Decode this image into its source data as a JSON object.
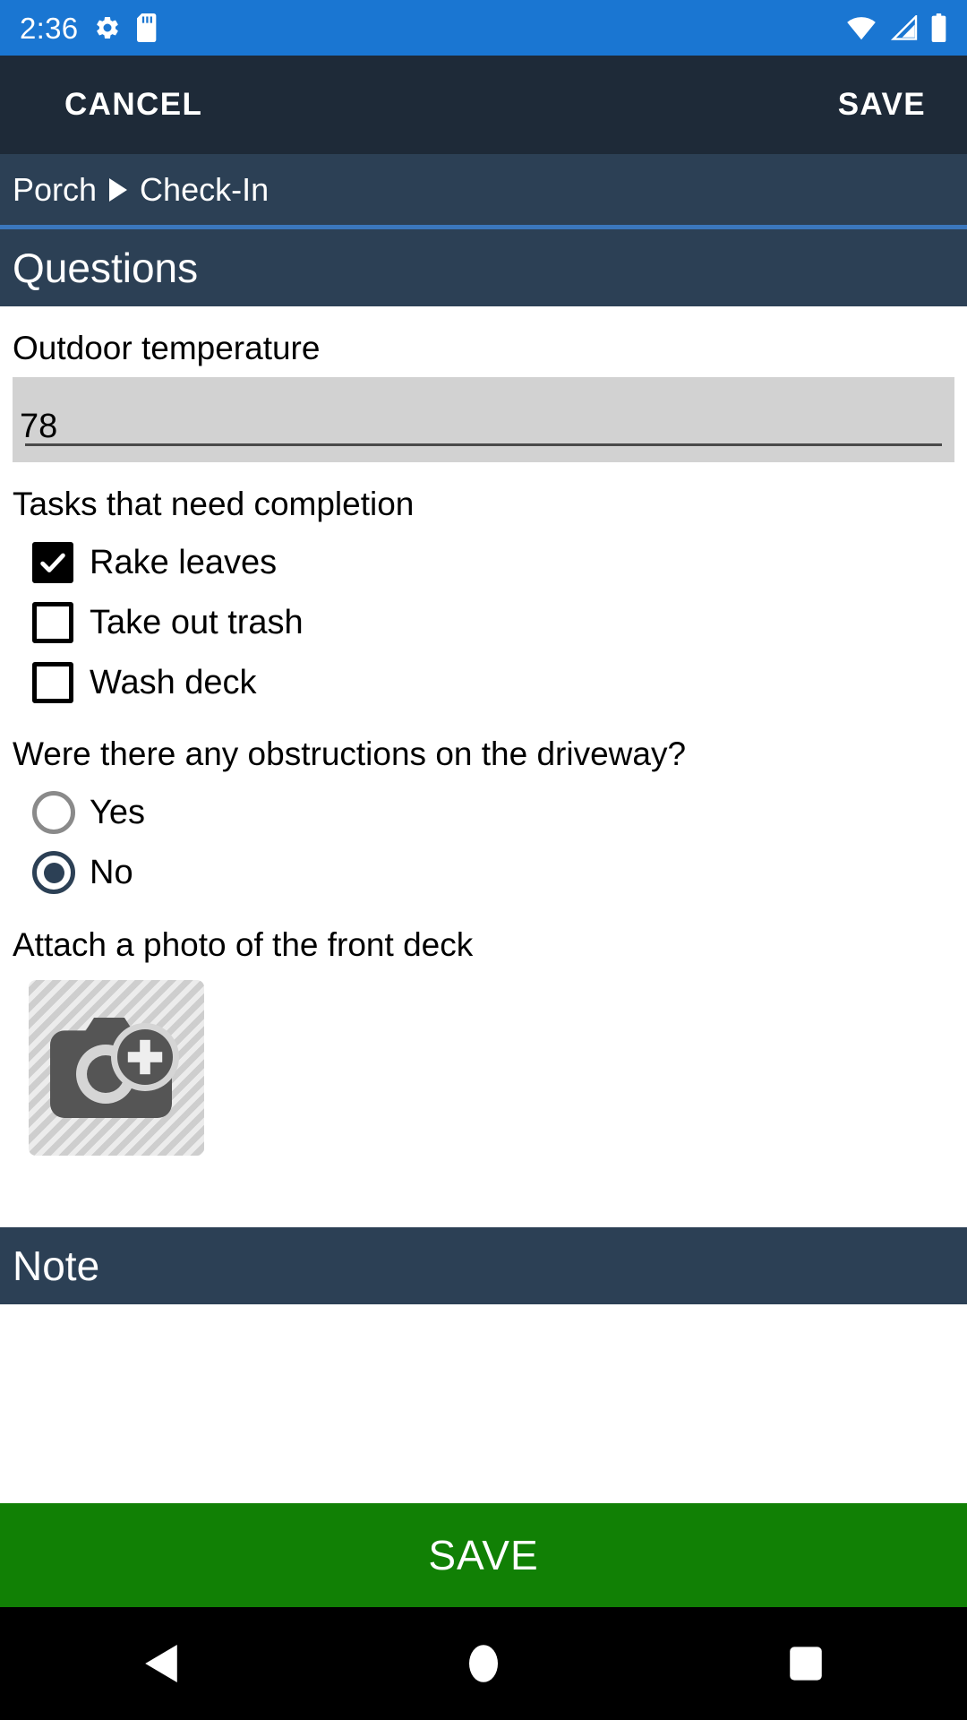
{
  "statusbar": {
    "time": "2:36",
    "icons_left": [
      "gear-icon",
      "sd-card-icon"
    ],
    "icons_right": [
      "wifi-icon",
      "cellular-signal-icon",
      "battery-icon"
    ],
    "background_color": "#1a76d2"
  },
  "appbar": {
    "cancel_label": "CANCEL",
    "save_label": "SAVE",
    "background_color": "#1e2a38"
  },
  "breadcrumb": {
    "parent": "Porch",
    "separator_icon": "triangle-right-icon",
    "current": "Check-In",
    "background_color": "#2c4055",
    "accent_color": "#3b77bd"
  },
  "sections": {
    "questions": {
      "title": "Questions"
    },
    "note": {
      "title": "Note"
    }
  },
  "questions": [
    {
      "type": "text",
      "label": "Outdoor temperature",
      "value": "78",
      "placeholder": ""
    },
    {
      "type": "checkbox-group",
      "label": "Tasks that need completion",
      "options": [
        {
          "label": "Rake leaves",
          "checked": true
        },
        {
          "label": "Take out trash",
          "checked": false
        },
        {
          "label": "Wash deck",
          "checked": false
        }
      ]
    },
    {
      "type": "radio-group",
      "label": "Were there any obstructions on the driveway?",
      "options": [
        {
          "label": "Yes",
          "selected": false
        },
        {
          "label": "No",
          "selected": true
        }
      ]
    },
    {
      "type": "photo",
      "label": "Attach a photo of the front deck",
      "picker_icon": "add-photo-camera-icon"
    }
  ],
  "footer": {
    "save_label": "SAVE",
    "save_color": "#118005"
  },
  "navbar": {
    "back_icon": "back-triangle-icon",
    "home_icon": "home-circle-icon",
    "recents_icon": "recents-square-icon",
    "background_color": "#000000"
  }
}
